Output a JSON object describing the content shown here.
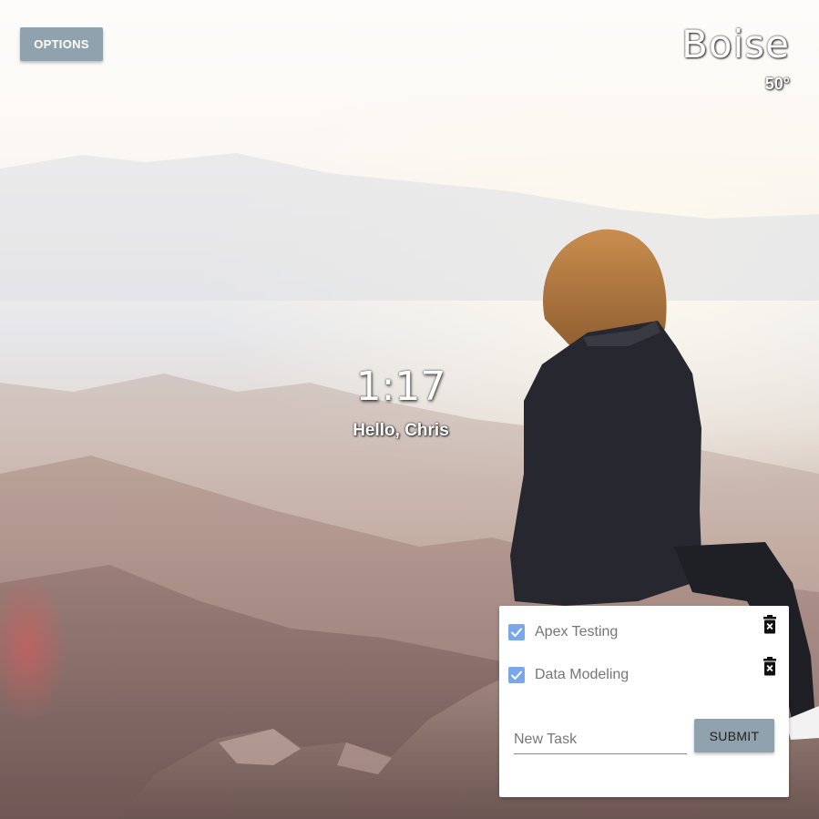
{
  "toolbar": {
    "options_label": "OPTIONS"
  },
  "weather": {
    "city": "Boise",
    "temperature": "50°"
  },
  "clock": {
    "time": "1:17",
    "greeting": "Hello, Chris"
  },
  "todo": {
    "tasks": [
      {
        "label": "Apex Testing",
        "completed": true
      },
      {
        "label": "Data Modeling",
        "completed": true
      }
    ],
    "new_task_placeholder": "New Task",
    "submit_label": "SUBMIT"
  },
  "icons": {
    "check": "check-icon",
    "delete": "trash-x-icon"
  },
  "colors": {
    "button_bg": "#8fa2ad",
    "checkbox": "#7aa6ec",
    "card_bg": "#ffffff"
  },
  "background": {
    "description_icon": "mountain-photo"
  }
}
